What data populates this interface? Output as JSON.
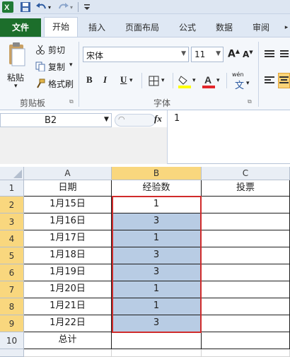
{
  "qat": {
    "icons": [
      "excel-logo",
      "save-icon",
      "undo-icon",
      "redo-icon",
      "customize-icon"
    ]
  },
  "tabs": [
    "文件",
    "开始",
    "插入",
    "页面布局",
    "公式",
    "数据",
    "审阅"
  ],
  "active_tab": "开始",
  "ribbon": {
    "paste_label": "粘贴",
    "cut_label": "剪切",
    "copy_label": "复制",
    "format_painter_label": "格式刷",
    "clipboard_group": "剪贴板",
    "font_name": "宋体",
    "font_size": "11",
    "bold": "B",
    "italic": "I",
    "underline": "U",
    "font_group": "字体",
    "wen_label": "wén",
    "wen_char": "文"
  },
  "formula_bar": {
    "name_box": "B2",
    "fx": "fx",
    "value": "1"
  },
  "sheet": {
    "columns": [
      "A",
      "B",
      "C"
    ],
    "rows": [
      "1",
      "2",
      "3",
      "4",
      "5",
      "6",
      "7",
      "8",
      "9",
      "10"
    ],
    "headers": [
      "日期",
      "经验数",
      "投票"
    ],
    "dates": [
      "1月15日",
      "1月16日",
      "1月17日",
      "1月18日",
      "1月19日",
      "1月20日",
      "1月21日",
      "1月22日"
    ],
    "values": [
      "1",
      "3",
      "1",
      "3",
      "3",
      "1",
      "1",
      "3"
    ],
    "total_label": "总计"
  },
  "colors": {
    "file_tab": "#1c6e2b",
    "selection_fill": "#b8cce4",
    "selection_border": "#d02b2b",
    "header_selected": "#f9d77e"
  }
}
